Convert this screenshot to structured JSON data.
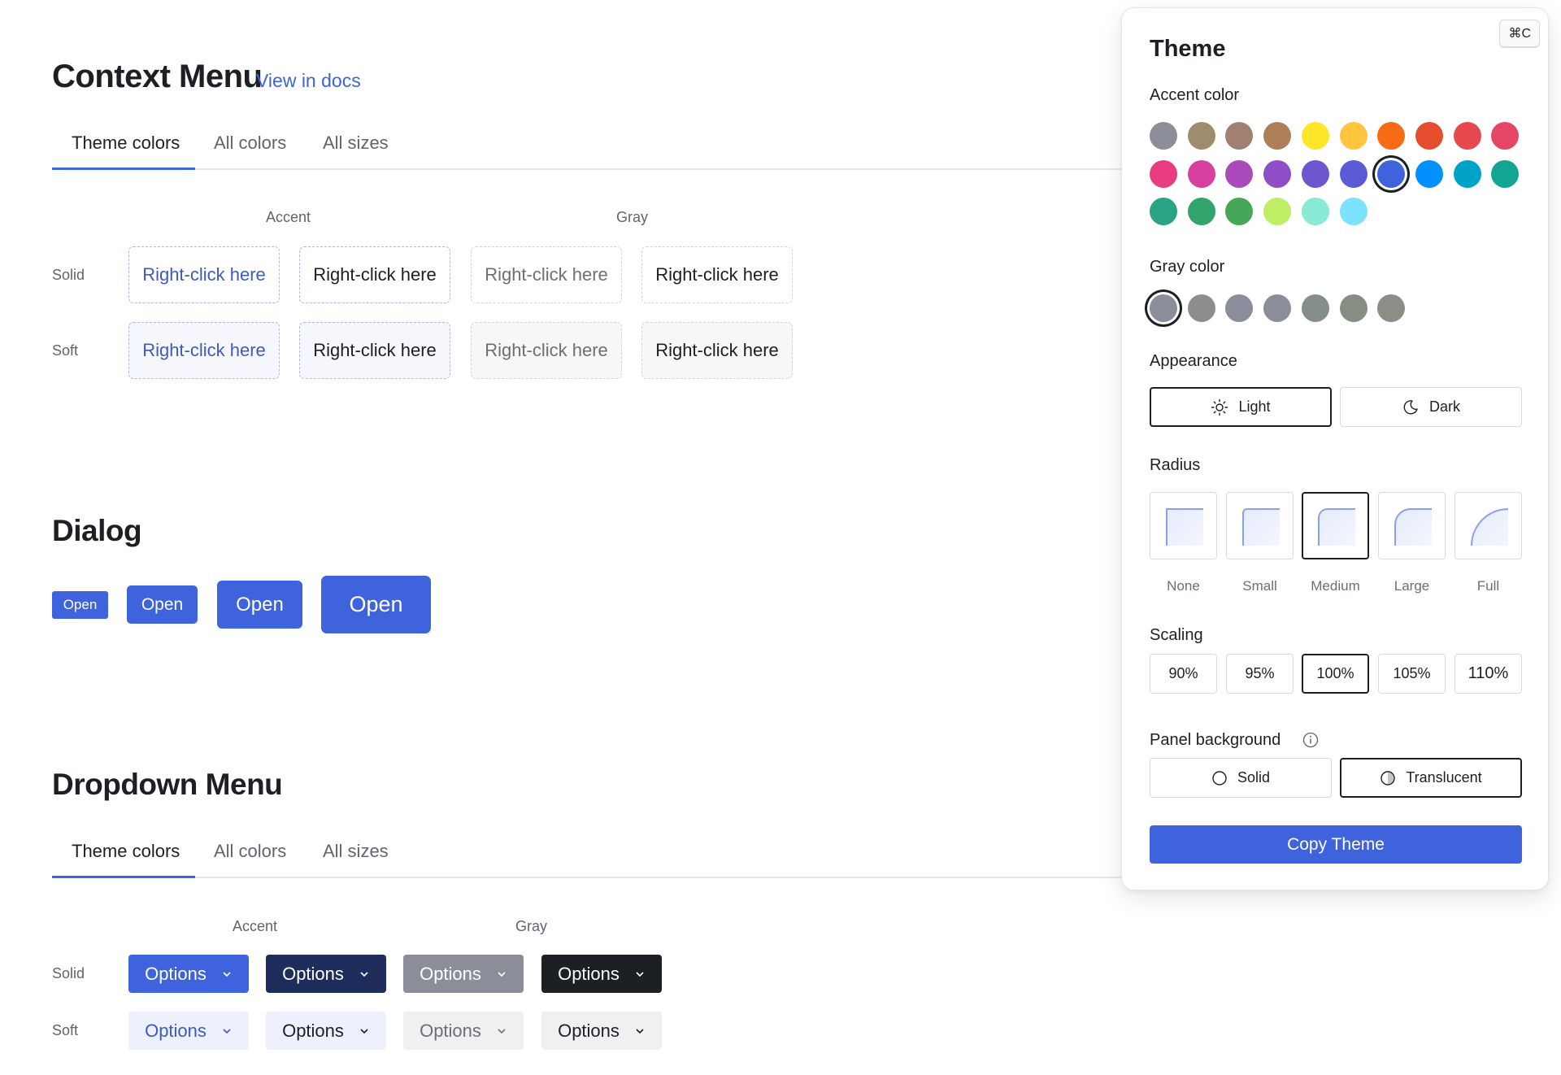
{
  "context_menu": {
    "title": "Context Menu",
    "docs_link": "View in docs",
    "tabs": [
      "Theme colors",
      "All colors",
      "All sizes"
    ],
    "col_headers": [
      "Accent",
      "Gray"
    ],
    "row_headers": [
      "Solid",
      "Soft"
    ],
    "cell_label": "Right-click here"
  },
  "dialog": {
    "title": "Dialog",
    "button_label": "Open"
  },
  "dropdown_menu": {
    "title": "Dropdown Menu",
    "tabs": [
      "Theme colors",
      "All colors",
      "All sizes"
    ],
    "col_headers": [
      "Accent",
      "Gray"
    ],
    "row_headers": [
      "Solid",
      "Soft"
    ],
    "button_label": "Options"
  },
  "theme_panel": {
    "shortcut": "⌘C",
    "title": "Theme",
    "accent_label": "Accent color",
    "accent_colors": [
      "#8b8d98",
      "#9e8c6d",
      "#a18072",
      "#ad7f58",
      "#ffe629",
      "#ffc53d",
      "#f76b15",
      "#e54d2e",
      "#e5484d",
      "#e54666",
      "#e93d82",
      "#d6409f",
      "#ab4aba",
      "#8e4ec6",
      "#6e56cf",
      "#5b5bd6",
      "#3e63dd",
      "#0090ff",
      "#00a2c7",
      "#12a594",
      "#29a383",
      "#30a46c",
      "#46a758",
      "#bdee63",
      "#86ead4",
      "#7ce2fe"
    ],
    "accent_selected": 16,
    "gray_label": "Gray color",
    "gray_colors": [
      "#8b8d98",
      "#8d8d8d",
      "#8b8c9c",
      "#8b8d98",
      "#868e8b",
      "#868e84",
      "#8d8d86"
    ],
    "gray_selected": 0,
    "appearance_label": "Appearance",
    "appearance_options": [
      "Light",
      "Dark"
    ],
    "appearance_selected": "Light",
    "radius_label": "Radius",
    "radius_options": [
      "None",
      "Small",
      "Medium",
      "Large",
      "Full"
    ],
    "radius_selected": "Medium",
    "scaling_label": "Scaling",
    "scaling_options": [
      "90%",
      "95%",
      "100%",
      "105%",
      "110%"
    ],
    "scaling_selected": "100%",
    "panel_bg_label": "Panel background",
    "panel_bg_options": [
      "Solid",
      "Translucent"
    ],
    "panel_bg_selected": "Translucent",
    "copy_button": "Copy Theme"
  },
  "colors": {
    "accent": "#3e63dd",
    "text": "#1c2024",
    "muted": "#60646c"
  }
}
